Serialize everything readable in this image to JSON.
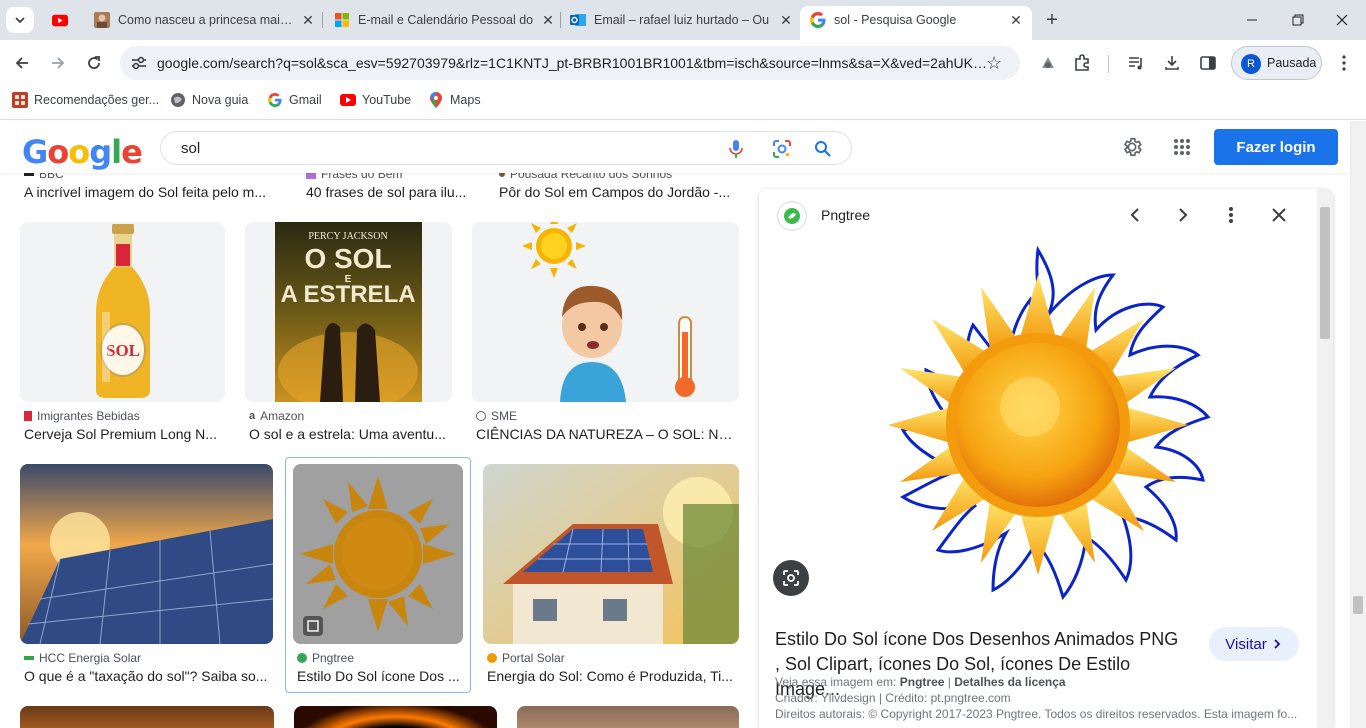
{
  "browser": {
    "tabs": [
      {
        "title": "",
        "favicon": "youtube-icon"
      },
      {
        "title": "Como nasceu a princesa mais li",
        "favicon": "portrait-icon"
      },
      {
        "title": "E-mail e Calendário Pessoal do",
        "favicon": "microsoft-icon"
      },
      {
        "title": "Email – rafael luiz hurtado – Ou",
        "favicon": "outlook-icon"
      },
      {
        "title": "sol - Pesquisa Google",
        "favicon": "google-icon",
        "active": true
      }
    ],
    "url": "google.com/search?q=sol&sca_esv=592703979&rlz=1C1KNTJ_pt-BRBR1001BR1001&tbm=isch&source=lnms&sa=X&ved=2ahUKE...",
    "profile_letter": "R",
    "profile_label": "Pausada",
    "bookmarks": [
      {
        "label": "Recomendações ger...",
        "icon": "cube-icon"
      },
      {
        "label": "Nova guia",
        "icon": "globe-icon"
      },
      {
        "label": "Gmail",
        "icon": "google-icon"
      },
      {
        "label": "YouTube",
        "icon": "youtube-icon"
      },
      {
        "label": "Maps",
        "icon": "maps-icon"
      }
    ]
  },
  "google": {
    "logo": "Google",
    "query": "sol",
    "login_label": "Fazer login"
  },
  "results": {
    "row0": [
      {
        "source": "BBC",
        "caption": "A incrível imagem do Sol feita pelo m..."
      },
      {
        "source": "Frases do Bem",
        "caption": "40 frases de sol para ilu..."
      },
      {
        "source": "Pousada Recanto dos Sonhos",
        "caption": "Pôr do Sol em Campos do Jordão -..."
      }
    ],
    "row1": [
      {
        "source": "Imigrantes Bebidas",
        "caption": "Cerveja Sol Premium Long N...",
        "colors": "#d9263a"
      },
      {
        "source": "Amazon",
        "caption": "O sol e a estrela: Uma aventu...",
        "book_title": "O SOL E A ESTRELA",
        "book_author": "PERCY JACKSON"
      },
      {
        "source": "SME",
        "caption": "CIÊNCIAS DA NATUREZA – O SOL: NO..."
      }
    ],
    "row2": [
      {
        "source": "HCC Energia Solar",
        "caption": "O que é a \"taxação do sol\"? Saiba so..."
      },
      {
        "source": "Pngtree",
        "caption": "Estilo Do Sol ícone Dos ..."
      },
      {
        "source": "Portal Solar",
        "caption": "Energia do Sol: Como é Produzida, Ti..."
      }
    ]
  },
  "panel": {
    "source": "Pngtree",
    "title": "Estilo Do Sol ícone Dos Desenhos Animados PNG , Sol Clipart, ícones Do Sol, ícones De Estilo Image...",
    "visit_label": "Visitar",
    "seen_on_prefix": "Veja essa imagem em:",
    "seen_on_site": "Pngtree",
    "license_link": "Detalhes da licença",
    "creator": "Criador: Ylivdesign | Crédito: pt.pngtree.com",
    "copyright": "Direitos autorais: © Copyright 2017-2023 Pngtree. Todos os direitos reservados. Esta imagem fo..."
  }
}
